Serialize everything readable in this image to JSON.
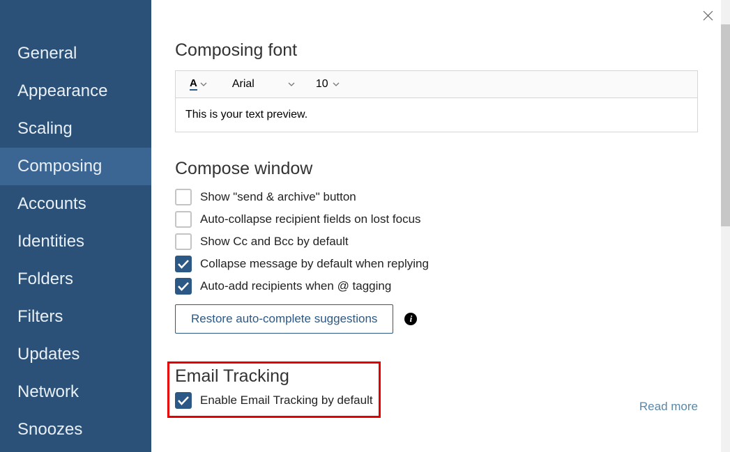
{
  "sidebar": {
    "items": [
      {
        "label": "General"
      },
      {
        "label": "Appearance"
      },
      {
        "label": "Scaling"
      },
      {
        "label": "Composing"
      },
      {
        "label": "Accounts"
      },
      {
        "label": "Identities"
      },
      {
        "label": "Folders"
      },
      {
        "label": "Filters"
      },
      {
        "label": "Updates"
      },
      {
        "label": "Network"
      },
      {
        "label": "Snoozes"
      }
    ],
    "activeIndex": 3
  },
  "composingFont": {
    "title": "Composing font",
    "fontName": "Arial",
    "fontSize": "10",
    "preview": "This is your text preview."
  },
  "composeWindow": {
    "title": "Compose window",
    "opts": [
      {
        "label": "Show \"send & archive\" button",
        "checked": false
      },
      {
        "label": "Auto-collapse recipient fields on lost focus",
        "checked": false
      },
      {
        "label": "Show Cc and Bcc by default",
        "checked": false
      },
      {
        "label": "Collapse message by default when replying",
        "checked": true
      },
      {
        "label": "Auto-add recipients when @ tagging",
        "checked": true
      }
    ],
    "restoreBtn": "Restore auto-complete suggestions"
  },
  "emailTracking": {
    "title": "Email Tracking",
    "opt": {
      "label": "Enable Email Tracking by default",
      "checked": true
    },
    "readMore": "Read more"
  }
}
